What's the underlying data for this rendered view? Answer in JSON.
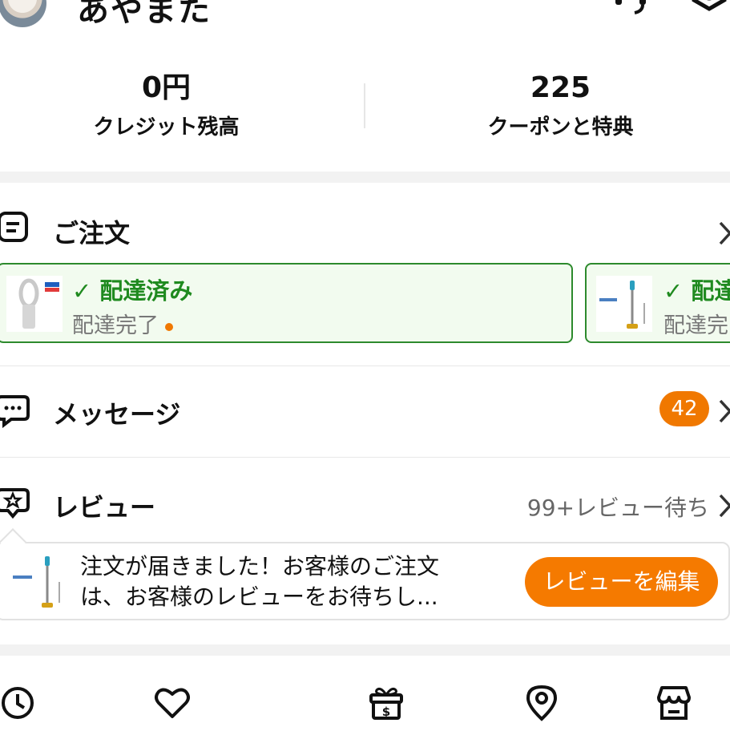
{
  "header": {
    "user_name": "あやまた"
  },
  "stats": {
    "credit": {
      "value": "0円",
      "label": "クレジット残高"
    },
    "coupons": {
      "value": "225",
      "label": "クーポンと特典"
    }
  },
  "orders": {
    "title": "ご注文",
    "cards": [
      {
        "status": "✓ 配達済み",
        "sub": "配達完了"
      },
      {
        "status": "✓ 配達",
        "sub": "配達完"
      }
    ]
  },
  "messages": {
    "title": "メッセージ",
    "badge": "42"
  },
  "reviews": {
    "title": "レビュー",
    "pending": "99+レビュー待ち",
    "prompt_line1": "注文が届きました！お客様のご注文",
    "prompt_line2": "は、お客様のレビューをお待ちし...",
    "edit_label": "レビューを編集"
  },
  "colors": {
    "accent": "#f57a00",
    "delivered_green": "#1f8a1f",
    "card_bg": "#f2fbef"
  },
  "icons": {
    "header": [
      "headset-icon",
      "settings-icon"
    ],
    "bottom_nav": [
      "history-clock-icon",
      "heart-icon",
      "gift-icon",
      "location-pin-icon",
      "store-icon"
    ]
  }
}
